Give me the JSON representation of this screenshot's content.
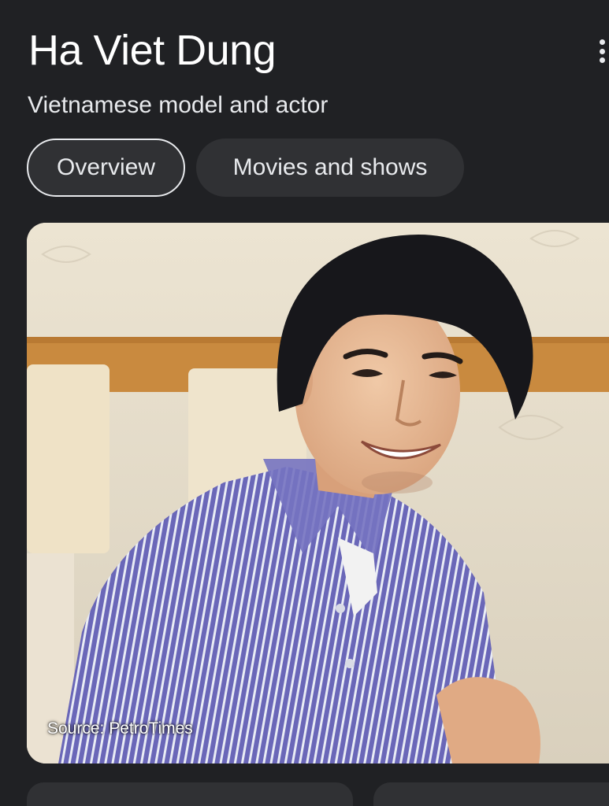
{
  "entity": {
    "title": "Ha Viet Dung",
    "subtitle": "Vietnamese model and actor"
  },
  "tabs": [
    {
      "label": "Overview",
      "selected": true
    },
    {
      "label": "Movies and shows",
      "selected": false
    }
  ],
  "image": {
    "source_label": "Source: PetroTimes",
    "description": "smiling man in striped purple shirt"
  },
  "colors": {
    "background": "#202124",
    "chip_background": "#303134",
    "text_primary": "#ffffff",
    "text_secondary": "#e8eaed"
  }
}
